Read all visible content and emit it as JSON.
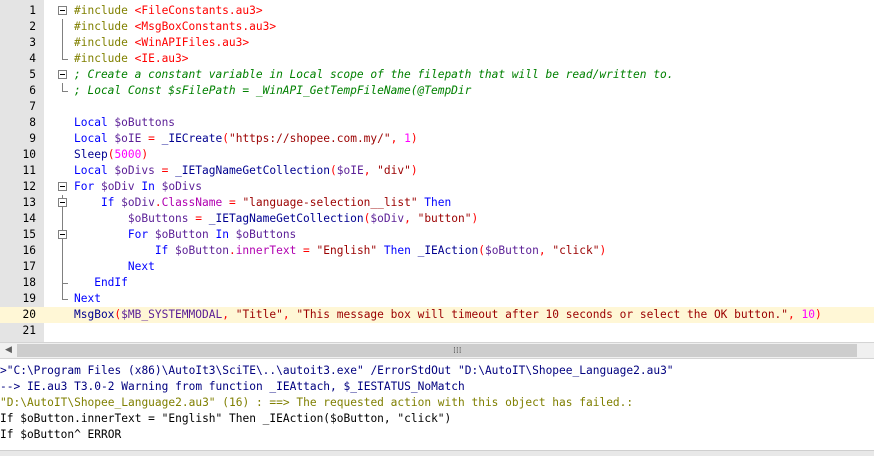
{
  "editor": {
    "lines": [
      {
        "num": "1",
        "tokens": [
          {
            "t": "#include ",
            "c": "t-pre"
          },
          {
            "t": "<FileConstants.au3>",
            "c": "t-inc"
          }
        ]
      },
      {
        "num": "2",
        "tokens": [
          {
            "t": "#include ",
            "c": "t-pre"
          },
          {
            "t": "<MsgBoxConstants.au3>",
            "c": "t-inc"
          }
        ]
      },
      {
        "num": "3",
        "tokens": [
          {
            "t": "#include ",
            "c": "t-pre"
          },
          {
            "t": "<WinAPIFiles.au3>",
            "c": "t-inc"
          }
        ]
      },
      {
        "num": "4",
        "tokens": [
          {
            "t": "#include ",
            "c": "t-pre"
          },
          {
            "t": "<IE.au3>",
            "c": "t-inc"
          }
        ]
      },
      {
        "num": "5",
        "tokens": [
          {
            "t": "; Create a constant variable in Local scope of the filepath that will be read/written to.",
            "c": "t-cmt"
          }
        ]
      },
      {
        "num": "6",
        "tokens": [
          {
            "t": "; Local Const $sFilePath = _WinAPI_GetTempFileName(@TempDir",
            "c": "t-cmt"
          }
        ]
      },
      {
        "num": "7",
        "tokens": []
      },
      {
        "num": "8",
        "tokens": [
          {
            "t": "Local ",
            "c": "t-kw"
          },
          {
            "t": "$oButtons",
            "c": "t-var"
          }
        ]
      },
      {
        "num": "9",
        "tokens": [
          {
            "t": "Local ",
            "c": "t-kw"
          },
          {
            "t": "$oIE ",
            "c": "t-var"
          },
          {
            "t": "= ",
            "c": "t-op"
          },
          {
            "t": "_IECreate",
            "c": "t-fn"
          },
          {
            "t": "(",
            "c": "t-op"
          },
          {
            "t": "\"https://shopee.com.my/\"",
            "c": "t-str"
          },
          {
            "t": ", ",
            "c": "t-op"
          },
          {
            "t": "1",
            "c": "t-num"
          },
          {
            "t": ")",
            "c": "t-op"
          }
        ]
      },
      {
        "num": "10",
        "tokens": [
          {
            "t": "Sleep",
            "c": "t-fn"
          },
          {
            "t": "(",
            "c": "t-op"
          },
          {
            "t": "5000",
            "c": "t-num"
          },
          {
            "t": ")",
            "c": "t-op"
          }
        ]
      },
      {
        "num": "11",
        "tokens": [
          {
            "t": "Local ",
            "c": "t-kw"
          },
          {
            "t": "$oDivs ",
            "c": "t-var"
          },
          {
            "t": "= ",
            "c": "t-op"
          },
          {
            "t": "_IETagNameGetCollection",
            "c": "t-fn"
          },
          {
            "t": "(",
            "c": "t-op"
          },
          {
            "t": "$oIE",
            "c": "t-var"
          },
          {
            "t": ", ",
            "c": "t-op"
          },
          {
            "t": "\"div\"",
            "c": "t-str"
          },
          {
            "t": ")",
            "c": "t-op"
          }
        ]
      },
      {
        "num": "12",
        "tokens": [
          {
            "t": "For ",
            "c": "t-kw"
          },
          {
            "t": "$oDiv ",
            "c": "t-var"
          },
          {
            "t": "In ",
            "c": "t-kw"
          },
          {
            "t": "$oDivs",
            "c": "t-var"
          }
        ]
      },
      {
        "num": "13",
        "tokens": [
          {
            "t": "    If ",
            "c": "t-kw"
          },
          {
            "t": "$oDiv",
            "c": "t-var"
          },
          {
            "t": ".",
            "c": "t-op"
          },
          {
            "t": "ClassName ",
            "c": "t-prop"
          },
          {
            "t": "= ",
            "c": "t-op"
          },
          {
            "t": "\"language-selection__list\" ",
            "c": "t-str"
          },
          {
            "t": "Then",
            "c": "t-kw"
          }
        ]
      },
      {
        "num": "14",
        "tokens": [
          {
            "t": "        $oButtons ",
            "c": "t-var"
          },
          {
            "t": "= ",
            "c": "t-op"
          },
          {
            "t": "_IETagNameGetCollection",
            "c": "t-fn"
          },
          {
            "t": "(",
            "c": "t-op"
          },
          {
            "t": "$oDiv",
            "c": "t-var"
          },
          {
            "t": ", ",
            "c": "t-op"
          },
          {
            "t": "\"button\"",
            "c": "t-str"
          },
          {
            "t": ")",
            "c": "t-op"
          }
        ]
      },
      {
        "num": "15",
        "tokens": [
          {
            "t": "        For ",
            "c": "t-kw"
          },
          {
            "t": "$oButton ",
            "c": "t-var"
          },
          {
            "t": "In ",
            "c": "t-kw"
          },
          {
            "t": "$oButtons",
            "c": "t-var"
          }
        ]
      },
      {
        "num": "16",
        "tokens": [
          {
            "t": "            If ",
            "c": "t-kw"
          },
          {
            "t": "$oButton",
            "c": "t-var"
          },
          {
            "t": ".",
            "c": "t-op"
          },
          {
            "t": "innerText ",
            "c": "t-prop"
          },
          {
            "t": "= ",
            "c": "t-op"
          },
          {
            "t": "\"English\" ",
            "c": "t-str"
          },
          {
            "t": "Then ",
            "c": "t-kw"
          },
          {
            "t": "_IEAction",
            "c": "t-fn"
          },
          {
            "t": "(",
            "c": "t-op"
          },
          {
            "t": "$oButton",
            "c": "t-var"
          },
          {
            "t": ", ",
            "c": "t-op"
          },
          {
            "t": "\"click\"",
            "c": "t-str"
          },
          {
            "t": ")",
            "c": "t-op"
          }
        ]
      },
      {
        "num": "17",
        "tokens": [
          {
            "t": "        Next",
            "c": "t-kw"
          }
        ]
      },
      {
        "num": "18",
        "tokens": [
          {
            "t": "   EndIf",
            "c": "t-kw"
          }
        ]
      },
      {
        "num": "19",
        "tokens": [
          {
            "t": "Next",
            "c": "t-kw"
          }
        ]
      },
      {
        "num": "20",
        "tokens": [
          {
            "t": "MsgBox",
            "c": "t-fn"
          },
          {
            "t": "(",
            "c": "t-op"
          },
          {
            "t": "$MB_SYSTEMMODAL",
            "c": "t-var"
          },
          {
            "t": ", ",
            "c": "t-op"
          },
          {
            "t": "\"Title\"",
            "c": "t-str"
          },
          {
            "t": ", ",
            "c": "t-op"
          },
          {
            "t": "\"This message box will timeout after 10 seconds or select the OK button.\"",
            "c": "t-str"
          },
          {
            "t": ", ",
            "c": "t-op"
          },
          {
            "t": "10",
            "c": "t-num"
          },
          {
            "t": ")",
            "c": "t-op"
          }
        ]
      },
      {
        "num": "21",
        "tokens": []
      }
    ]
  },
  "output": {
    "lines": [
      {
        "text": ">\"C:\\Program Files (x86)\\AutoIt3\\SciTE\\..\\autoit3.exe\" /ErrorStdOut \"D:\\AutoIT\\Shopee_Language2.au3\"",
        "c": "o-cmd"
      },
      {
        "text": "--> IE.au3 T3.0-2 Warning from function _IEAttach, $_IESTATUS_NoMatch",
        "c": "o-warn"
      },
      {
        "text": "\"D:\\AutoIT\\Shopee_Language2.au3\" (16) : ==> The requested action with this object has failed.:",
        "c": "o-err"
      },
      {
        "text": "If $oButton.innerText = \"English\" Then _IEAction($oButton, \"click\")",
        "c": ""
      },
      {
        "text": "If $oButton^ ERROR",
        "c": ""
      }
    ]
  },
  "scrollbar": {
    "left_arrow": "◀",
    "grip": "⁞⁞⁞"
  }
}
